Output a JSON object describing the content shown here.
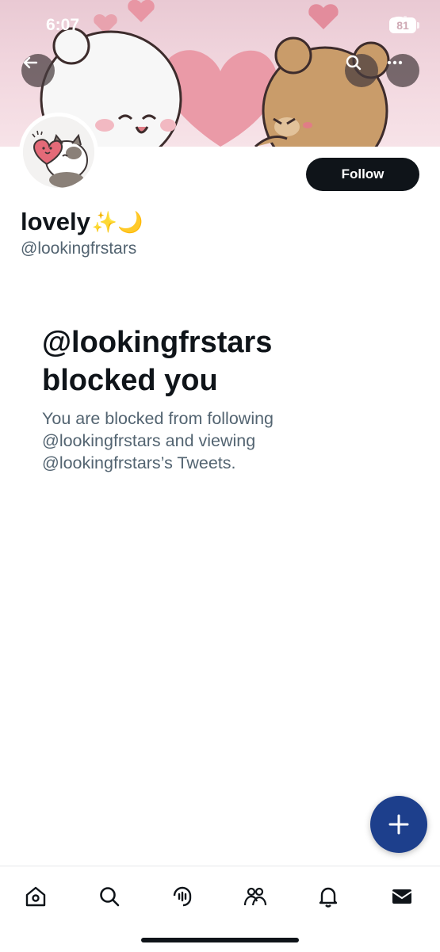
{
  "status_bar": {
    "time": "6:07",
    "battery": "81"
  },
  "profile": {
    "display_name": "lovely",
    "display_name_emoji": "✨🌙",
    "handle": "@lookingfrstars",
    "follow_label": "Follow"
  },
  "blocked": {
    "title": "@lookingfrstars blocked you",
    "description": "You are blocked from following @lookingfrstars and viewing @lookingfrstars’s Tweets."
  },
  "icons": {
    "back": "arrow-left-icon",
    "search": "search-icon",
    "more": "more-icon",
    "compose": "plus-icon",
    "nav": [
      "home-icon",
      "search-icon",
      "spaces-icon",
      "communities-icon",
      "bell-icon",
      "mail-icon"
    ]
  },
  "colors": {
    "accent_fab": "#1d3f8c",
    "text_primary": "#0f1419",
    "text_secondary": "#536471"
  }
}
